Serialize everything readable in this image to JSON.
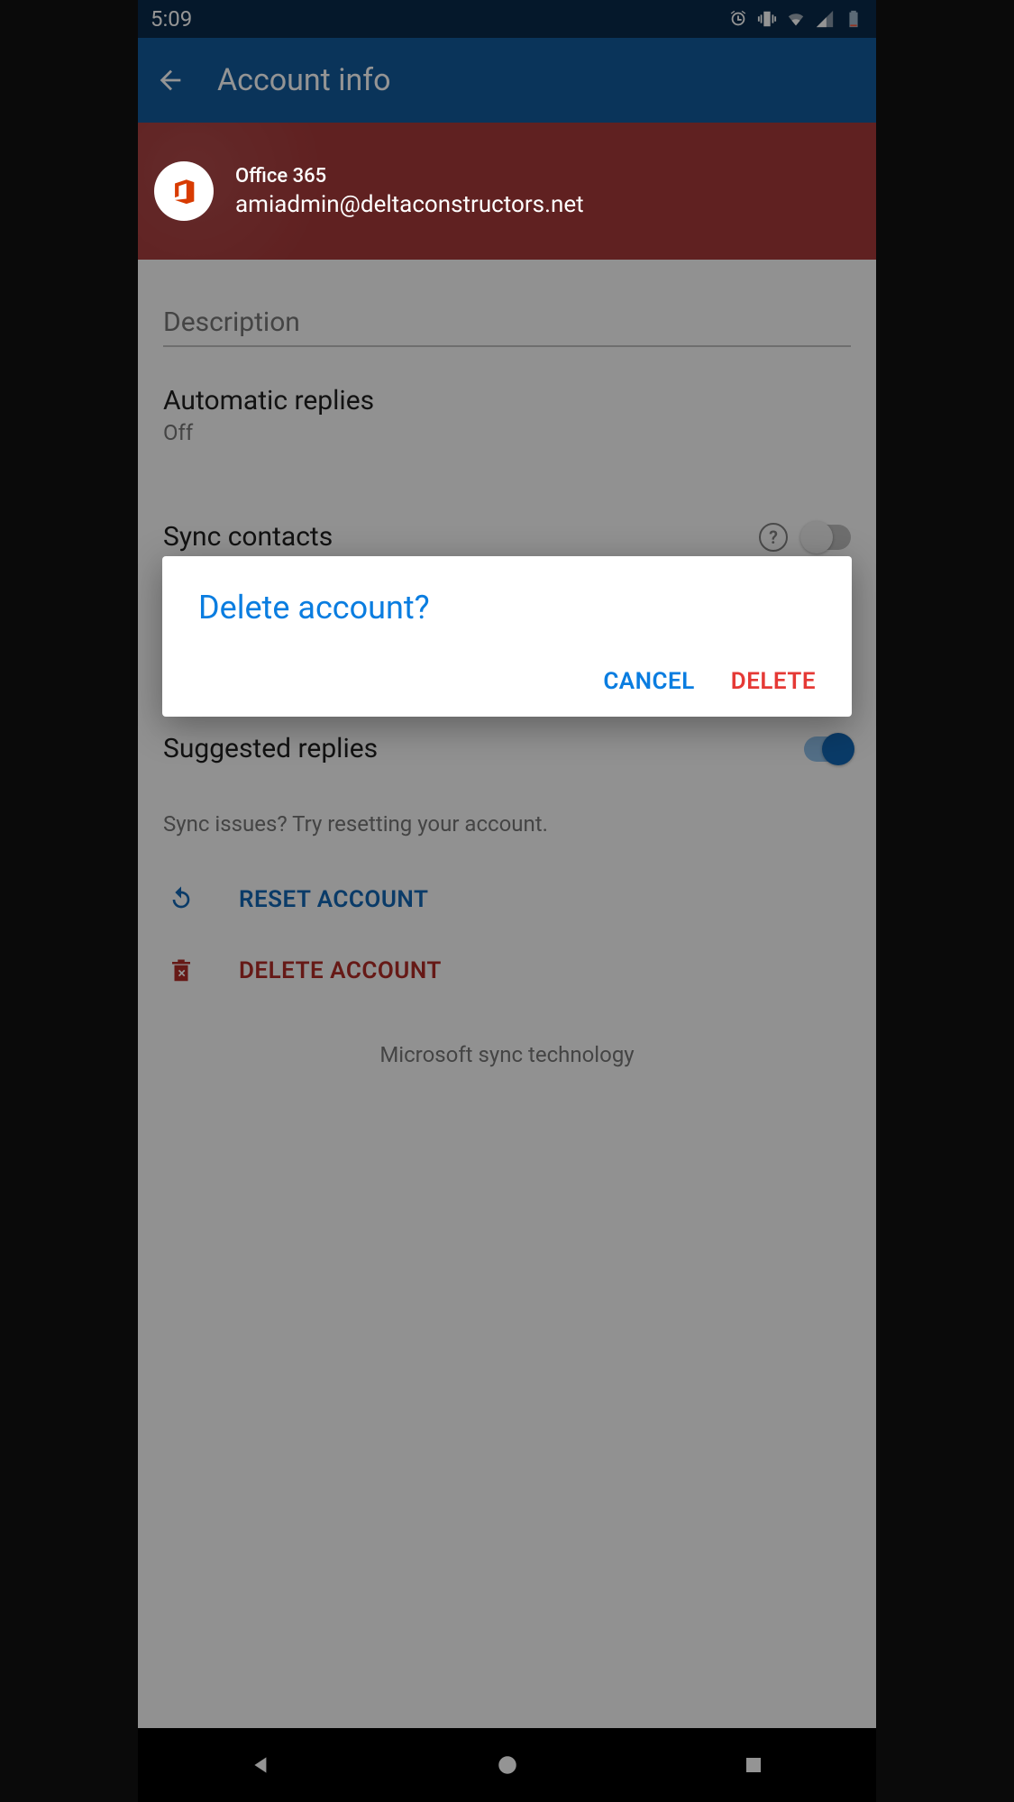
{
  "statusbar": {
    "time": "5:09"
  },
  "appbar": {
    "title": "Account info"
  },
  "account": {
    "type": "Office 365",
    "email": "amiadmin@deltaconstructors.net"
  },
  "description": {
    "label": "Description"
  },
  "settings": {
    "auto_replies": {
      "label": "Automatic replies",
      "value": "Off"
    },
    "sync_contacts": {
      "label": "Sync contacts",
      "help": "?",
      "toggle": false
    },
    "suggested_replies": {
      "label": "Suggested replies",
      "toggle": true
    }
  },
  "sync_hint": "Sync issues? Try resetting your account.",
  "actions": {
    "reset": "RESET ACCOUNT",
    "delete": "DELETE ACCOUNT"
  },
  "footer": "Microsoft sync technology",
  "dialog": {
    "title": "Delete account?",
    "cancel": "CANCEL",
    "delete": "DELETE"
  }
}
